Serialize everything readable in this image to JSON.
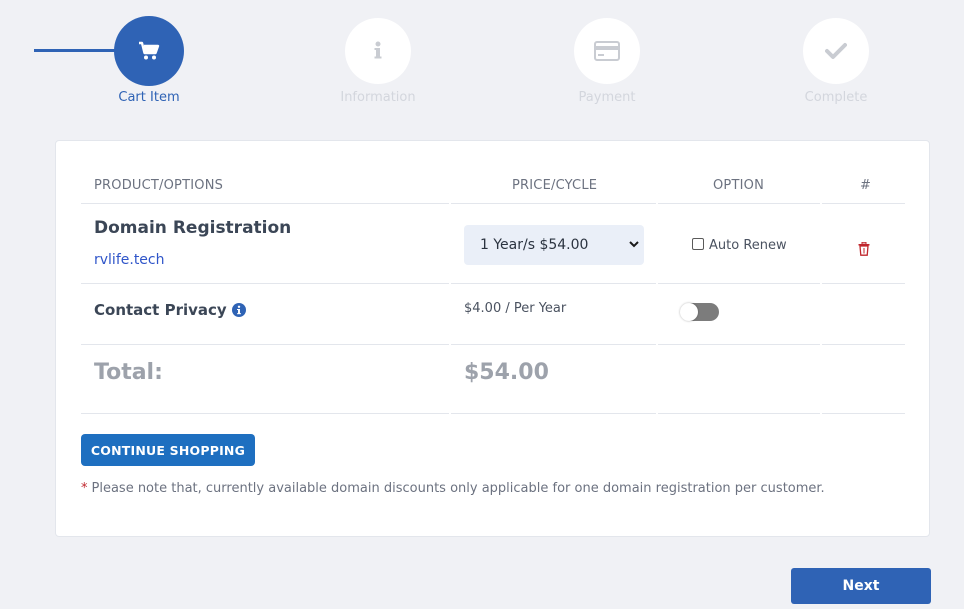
{
  "stepper": {
    "steps": [
      {
        "label": "Cart Item",
        "icon": "cart-icon",
        "state": "active"
      },
      {
        "label": "Information",
        "icon": "info-icon",
        "state": "inactive"
      },
      {
        "label": "Payment",
        "icon": "credit-card-icon",
        "state": "inactive"
      },
      {
        "label": "Complete",
        "icon": "check-icon",
        "state": "inactive"
      }
    ]
  },
  "table": {
    "headers": [
      "PRODUCT/OPTIONS",
      "PRICE/CYCLE",
      "OPTION",
      "#"
    ],
    "domain_row": {
      "title": "Domain Registration",
      "domain": "rvlife.tech",
      "cycle_selected": "1 Year/s $54.00",
      "auto_renew_label": "Auto Renew",
      "auto_renew_checked": false
    },
    "privacy_row": {
      "title": "Contact Privacy",
      "price": "$4.00 / Per Year",
      "enabled": false
    },
    "total": {
      "label": "Total:",
      "value": "$54.00"
    }
  },
  "actions": {
    "continue_label": "CONTINUE SHOPPING",
    "next_label": "Next"
  },
  "note": {
    "marker": "*",
    "text": "Please note that, currently available domain discounts only applicable for one domain registration per customer."
  },
  "colors": {
    "primary": "#2f63b5",
    "button": "#1e6fc0",
    "link": "#2f55c9",
    "danger": "#c0272d",
    "background": "#f0f1f5"
  }
}
